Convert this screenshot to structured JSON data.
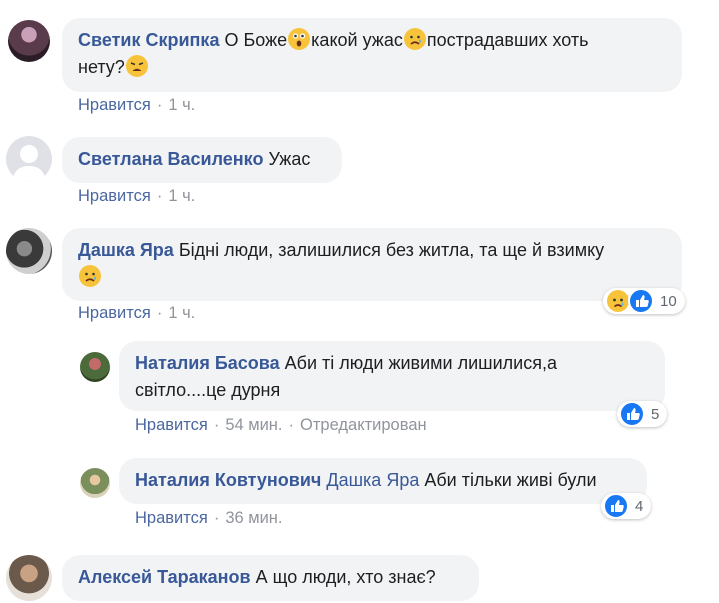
{
  "comments": [
    {
      "author": "Светик Скрипка",
      "text_parts": [
        "О Боже",
        "какой ужас",
        "пострадавших хоть",
        "нету?"
      ],
      "emojis": [
        "astonished-emoji",
        "crying-emoji",
        "weary-emoji"
      ],
      "like": "Нравится",
      "time": "1 ч."
    },
    {
      "author": "Светлана Василенко",
      "text": "Ужас",
      "like": "Нравится",
      "time": "1 ч."
    },
    {
      "author": "Дашка Яра",
      "text": "Бідні люди, залишилися без житла, та ще й взимку",
      "emojis": [
        "crying-emoji"
      ],
      "like": "Нравится",
      "time": "1 ч.",
      "reactions": {
        "count": "10",
        "types": [
          "sad-reaction-icon",
          "like-reaction-icon"
        ]
      }
    },
    {
      "author": "Наталия Басова",
      "text_line1": "Аби ті люди живими лишилися,а",
      "text_line2": "світло....це дурня",
      "like": "Нравится",
      "time": "54 мин.",
      "edited": "Отредактирован",
      "reactions": {
        "count": "5",
        "types": [
          "like-reaction-icon"
        ]
      }
    },
    {
      "author": "Наталия Ковтунович",
      "mention": "Дашка Яра",
      "text": "Аби тільки живі були",
      "like": "Нравится",
      "time": "36 мин.",
      "reactions": {
        "count": "4",
        "types": [
          "like-reaction-icon"
        ]
      }
    },
    {
      "author": "Алексей Тараканов",
      "text": "А що люди, хто знає?"
    }
  ],
  "colors": {
    "author": "#385898",
    "bubble": "#f2f3f5",
    "meta": "#90949c",
    "like_blue": "#1877f2",
    "emoji_yellow": "#f7c33b"
  }
}
